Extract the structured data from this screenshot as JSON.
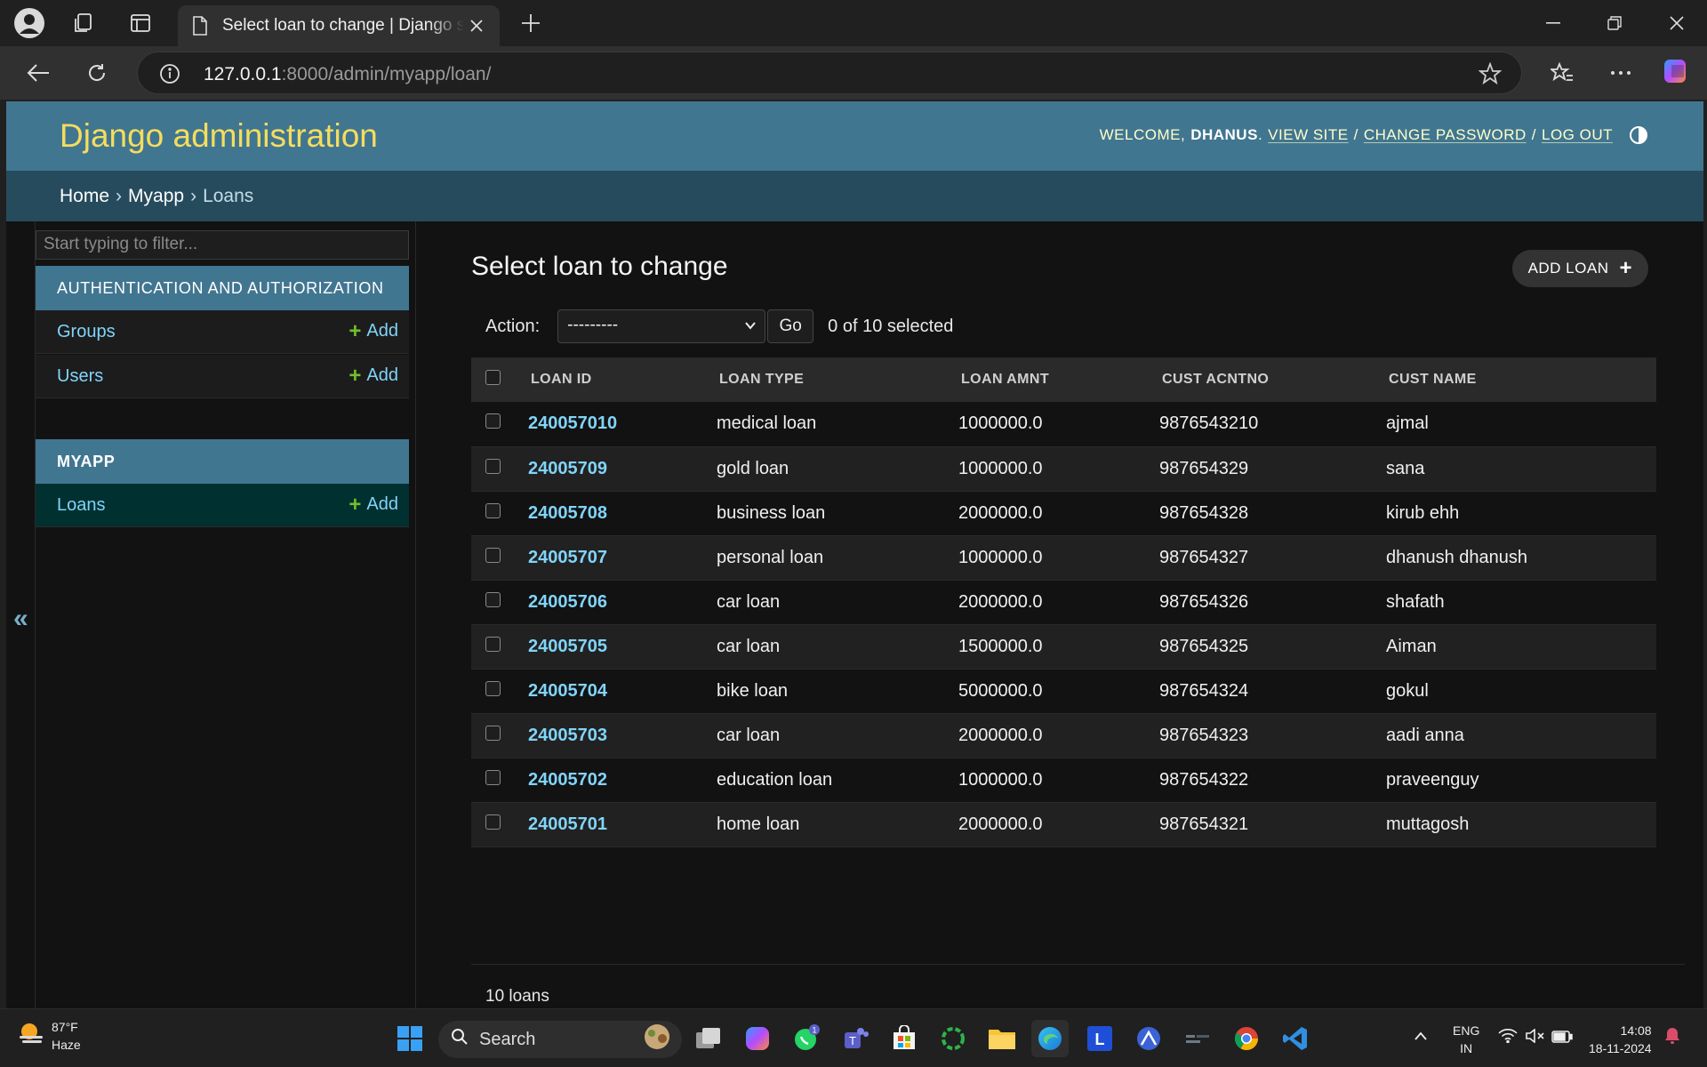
{
  "browser": {
    "tab_title": "Select loan to change | Django site admin",
    "url_host": "127.0.0.1",
    "url_rest": ":8000/admin/myapp/loan/"
  },
  "header": {
    "brand": "Django administration",
    "welcome": "WELCOME,",
    "username": "DHANUS",
    "view_site": "VIEW SITE",
    "change_password": "CHANGE PASSWORD",
    "log_out": "LOG OUT",
    "sep": "/"
  },
  "breadcrumbs": {
    "home": "Home",
    "app": "Myapp",
    "model": "Loans",
    "sep": "›"
  },
  "sidebar": {
    "filter_placeholder": "Start typing to filter...",
    "collapse": "«",
    "auth_caption": "AUTHENTICATION AND AUTHORIZATION",
    "groups": "Groups",
    "users": "Users",
    "myapp_caption": "MYAPP",
    "loans": "Loans",
    "add_label": "Add",
    "plus": "+"
  },
  "content": {
    "title": "Select loan to change",
    "add_button": "ADD LOAN",
    "add_plus": "+",
    "action_label": "Action:",
    "action_selected": "---------",
    "go": "Go",
    "selected_count": "0 of 10 selected",
    "paginator": "10 loans"
  },
  "table": {
    "headers": [
      "LOAN ID",
      "LOAN TYPE",
      "LOAN AMNT",
      "CUST ACNTNO",
      "CUST NAME"
    ],
    "rows": [
      [
        "240057010",
        "medical loan",
        "1000000.0",
        "9876543210",
        "ajmal"
      ],
      [
        "24005709",
        "gold loan",
        "1000000.0",
        "987654329",
        "sana"
      ],
      [
        "24005708",
        "business loan",
        "2000000.0",
        "987654328",
        "kirub ehh"
      ],
      [
        "24005707",
        "personal loan",
        "1000000.0",
        "987654327",
        "dhanush dhanush"
      ],
      [
        "24005706",
        "car loan",
        "2000000.0",
        "987654326",
        "shafath"
      ],
      [
        "24005705",
        "car loan",
        "1500000.0",
        "987654325",
        "Aiman"
      ],
      [
        "24005704",
        "bike loan",
        "5000000.0",
        "987654324",
        "gokul"
      ],
      [
        "24005703",
        "car loan",
        "2000000.0",
        "987654323",
        "aadi anna"
      ],
      [
        "24005702",
        "education loan",
        "1000000.0",
        "987654322",
        "praveenguy"
      ],
      [
        "24005701",
        "home loan",
        "2000000.0",
        "987654321",
        "muttagosh"
      ]
    ]
  },
  "taskbar": {
    "temp": "87°F",
    "condition": "Haze",
    "search": "Search",
    "lang1": "ENG",
    "lang2": "IN",
    "time": "14:08",
    "date": "18-11-2024",
    "whatsapp_badge": "1",
    "l_app": "L"
  },
  "colors": {
    "header_bg": "#417690",
    "brand": "#f5dd5d",
    "breadcrumbs_bg": "#264b5d",
    "link": "#81d4fa",
    "add_green": "#70bf2b",
    "current_model_bg": "#003030"
  }
}
